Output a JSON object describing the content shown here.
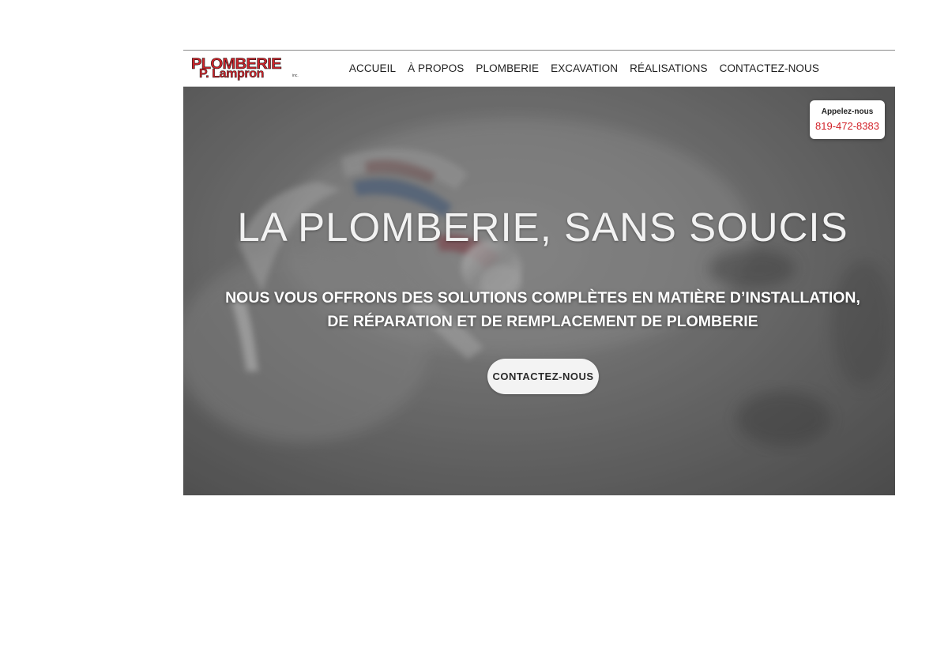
{
  "logo": {
    "line1": "PLOMBERIE",
    "line2": "P. Lampron",
    "suffix": "inc."
  },
  "nav": {
    "items": [
      {
        "label": "ACCUEIL"
      },
      {
        "label": "À PROPOS"
      },
      {
        "label": "PLOMBERIE"
      },
      {
        "label": "EXCAVATION"
      },
      {
        "label": "RÉALISATIONS"
      },
      {
        "label": "CONTACTEZ-NOUS"
      }
    ]
  },
  "hero": {
    "title": "LA PLOMBERIE, SANS SOUCIS",
    "subtitle_line1": "NOUS VOUS OFFRONS DES SOLUTIONS COMPLÈTES EN MATIÈRE D’INSTALLATION,",
    "subtitle_line2": "DE RÉPARATION ET DE REMPLACEMENT DE PLOMBERIE",
    "cta_label": "CONTACTEZ-NOUS",
    "background_icon": "faucet-photo"
  },
  "call_box": {
    "label": "Appelez-nous",
    "phone": "819-472-8383"
  },
  "colors": {
    "brand_red": "#d2232a",
    "hero_overlay": "#6e6e6e",
    "nav_text": "#1e1e1e"
  }
}
